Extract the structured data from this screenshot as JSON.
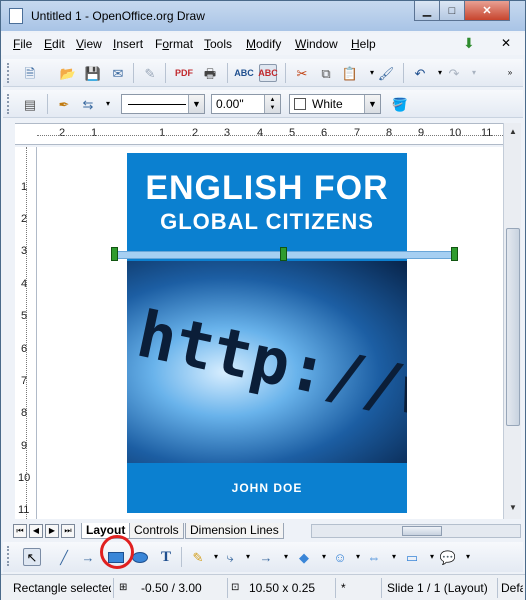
{
  "window": {
    "title": "Untitled 1 - OpenOffice.org Draw",
    "min_glyph": "▁",
    "max_glyph": "□",
    "close_glyph": "✕"
  },
  "menu": {
    "items": [
      {
        "label": "File",
        "key": "F"
      },
      {
        "label": "Edit",
        "key": "E"
      },
      {
        "label": "View",
        "key": "V"
      },
      {
        "label": "Insert",
        "key": "I"
      },
      {
        "label": "Format",
        "key": "o"
      },
      {
        "label": "Tools",
        "key": "T"
      },
      {
        "label": "Modify",
        "key": "M"
      },
      {
        "label": "Window",
        "key": "W"
      },
      {
        "label": "Help",
        "key": "H"
      }
    ],
    "close_glyph": "✕"
  },
  "line_props": {
    "line_width": "0.00\"",
    "area_color": "White"
  },
  "ruler": {
    "h_labels": [
      "2",
      "1",
      "1",
      "2",
      "3",
      "4",
      "5",
      "6",
      "7",
      "8",
      "9",
      "10",
      "11"
    ],
    "v_labels": [
      "1",
      "2",
      "3",
      "4",
      "5",
      "6",
      "7",
      "8",
      "9",
      "10",
      "11"
    ]
  },
  "cover": {
    "title_line1": "ENGLISH FOR",
    "title_line2": "GLOBAL CITIZENS",
    "image_text": "http://w",
    "author": "JOHN DOE"
  },
  "tabs": [
    "Layout",
    "Controls",
    "Dimension Lines"
  ],
  "status": {
    "selection": "Rectangle selected",
    "position": "-0.50 / 3.00",
    "size": "10.50 x 0.25",
    "modified": "*",
    "slide": "Slide 1 / 1 (Layout)",
    "style": "Default"
  },
  "colors": {
    "cover_blue": "#0b80d0",
    "selection_blue": "#a6cff2",
    "handle_green": "#2f9c2f",
    "highlight_red": "#e02020"
  }
}
